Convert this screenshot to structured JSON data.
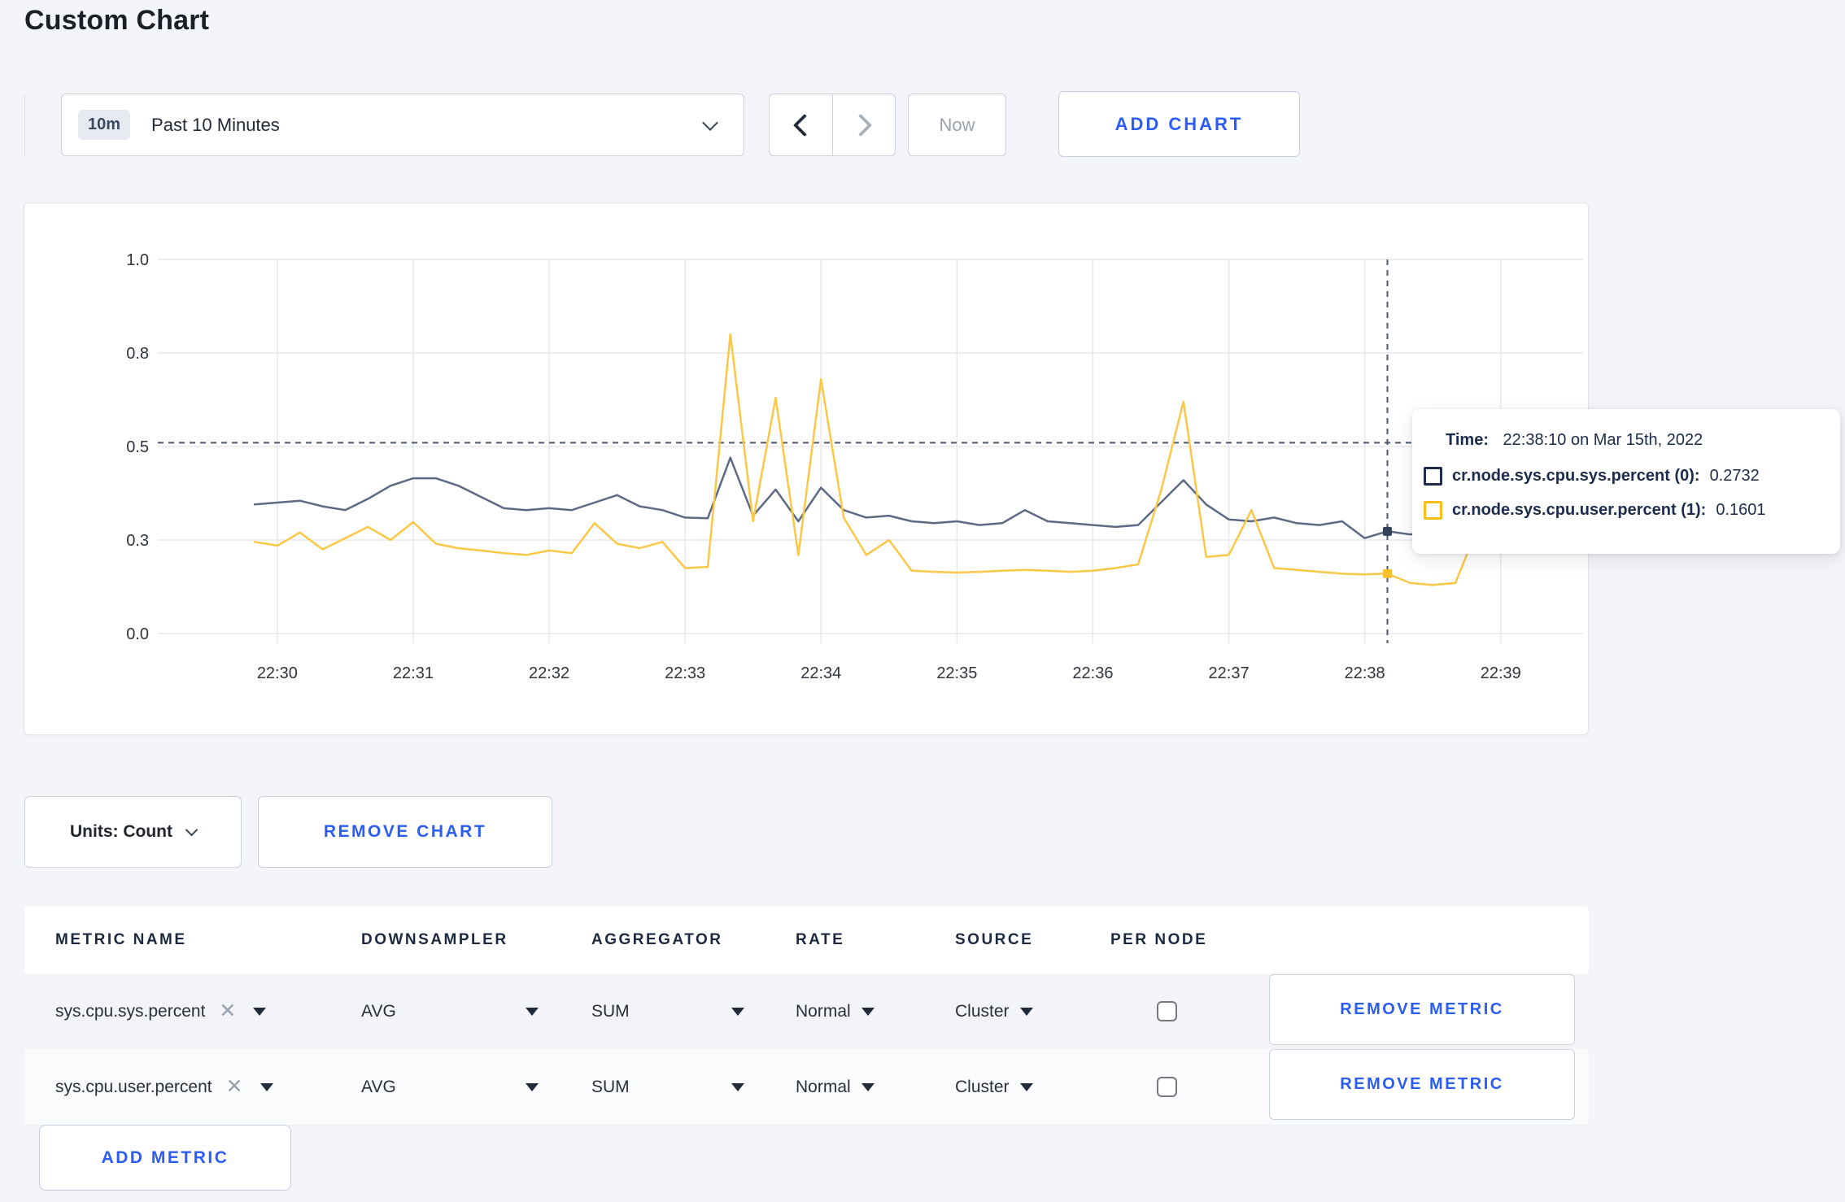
{
  "page": {
    "title": "Custom Chart",
    "background": "#f4f5f8",
    "accent_blue": "#2b5cf3"
  },
  "toolbar": {
    "time_range": {
      "badge": "10m",
      "label": "Past 10 Minutes"
    },
    "now_label": "Now",
    "add_chart_label": "ADD CHART"
  },
  "chart_data": {
    "type": "line",
    "title": "",
    "x_start": "22:29:50",
    "x_step_seconds": 10,
    "x_ticks": [
      "22:30",
      "22:31",
      "22:32",
      "22:33",
      "22:34",
      "22:35",
      "22:36",
      "22:37",
      "22:38",
      "22:39"
    ],
    "y_tick_values": [
      0,
      0.25,
      0.5,
      0.75,
      1.0
    ],
    "y_tick_labels": [
      "0.0",
      "0.3",
      "0.5",
      "0.8",
      "1.0"
    ],
    "ylim": [
      0,
      1
    ],
    "grid": true,
    "legend_position": "none",
    "series": [
      {
        "name": "cr.node.sys.cpu.sys.percent",
        "color": "#5c6a84",
        "marker_color": "#35425c",
        "values": [
          0.345,
          0.35,
          0.355,
          0.34,
          0.33,
          0.36,
          0.395,
          0.415,
          0.415,
          0.395,
          0.365,
          0.335,
          0.33,
          0.335,
          0.33,
          0.35,
          0.37,
          0.34,
          0.33,
          0.31,
          0.308,
          0.47,
          0.315,
          0.385,
          0.3,
          0.39,
          0.33,
          0.31,
          0.315,
          0.3,
          0.295,
          0.3,
          0.29,
          0.295,
          0.33,
          0.3,
          0.295,
          0.29,
          0.285,
          0.29,
          0.35,
          0.41,
          0.345,
          0.305,
          0.3,
          0.31,
          0.295,
          0.29,
          0.3,
          0.255,
          0.2732,
          0.265,
          0.27,
          0.275,
          0.28,
          0.285,
          0.29
        ]
      },
      {
        "name": "cr.node.sys.cpu.user.percent",
        "color": "#fbc746",
        "marker_color": "#fdc12d",
        "values": [
          0.245,
          0.235,
          0.27,
          0.225,
          0.255,
          0.285,
          0.25,
          0.298,
          0.24,
          0.228,
          0.222,
          0.215,
          0.21,
          0.222,
          0.215,
          0.295,
          0.24,
          0.228,
          0.245,
          0.175,
          0.178,
          0.8,
          0.3,
          0.63,
          0.21,
          0.68,
          0.31,
          0.21,
          0.25,
          0.168,
          0.165,
          0.163,
          0.165,
          0.168,
          0.17,
          0.168,
          0.165,
          0.168,
          0.175,
          0.185,
          0.38,
          0.62,
          0.205,
          0.21,
          0.33,
          0.175,
          0.17,
          0.165,
          0.16,
          0.158,
          0.1601,
          0.135,
          0.13,
          0.135,
          0.285,
          0.215,
          0.27
        ]
      }
    ],
    "crosshair": {
      "time": "22:38:10",
      "x_index": 50,
      "hline_value": 0.51
    }
  },
  "tooltip": {
    "time_label": "Time:",
    "time_value": "22:38:10 on Mar 15th, 2022",
    "series": [
      {
        "label": "cr.node.sys.cpu.sys.percent (0):",
        "value": "0.2732",
        "color": "#1d2c4d"
      },
      {
        "label": "cr.node.sys.cpu.user.percent (1):",
        "value": "0.1601",
        "color": "#fdbf17"
      }
    ]
  },
  "chart_controls": {
    "units_label": "Units: Count",
    "remove_chart_label": "REMOVE CHART"
  },
  "metrics_table": {
    "headers": [
      "METRIC NAME",
      "DOWNSAMPLER",
      "AGGREGATOR",
      "RATE",
      "SOURCE",
      "PER NODE"
    ],
    "rows": [
      {
        "metric": "sys.cpu.sys.percent",
        "downsampler": "AVG",
        "aggregator": "SUM",
        "rate": "Normal",
        "source": "Cluster",
        "per_node_checked": false,
        "remove_label": "REMOVE METRIC"
      },
      {
        "metric": "sys.cpu.user.percent",
        "downsampler": "AVG",
        "aggregator": "SUM",
        "rate": "Normal",
        "source": "Cluster",
        "per_node_checked": false,
        "remove_label": "REMOVE METRIC"
      }
    ],
    "add_metric_label": "ADD METRIC"
  }
}
